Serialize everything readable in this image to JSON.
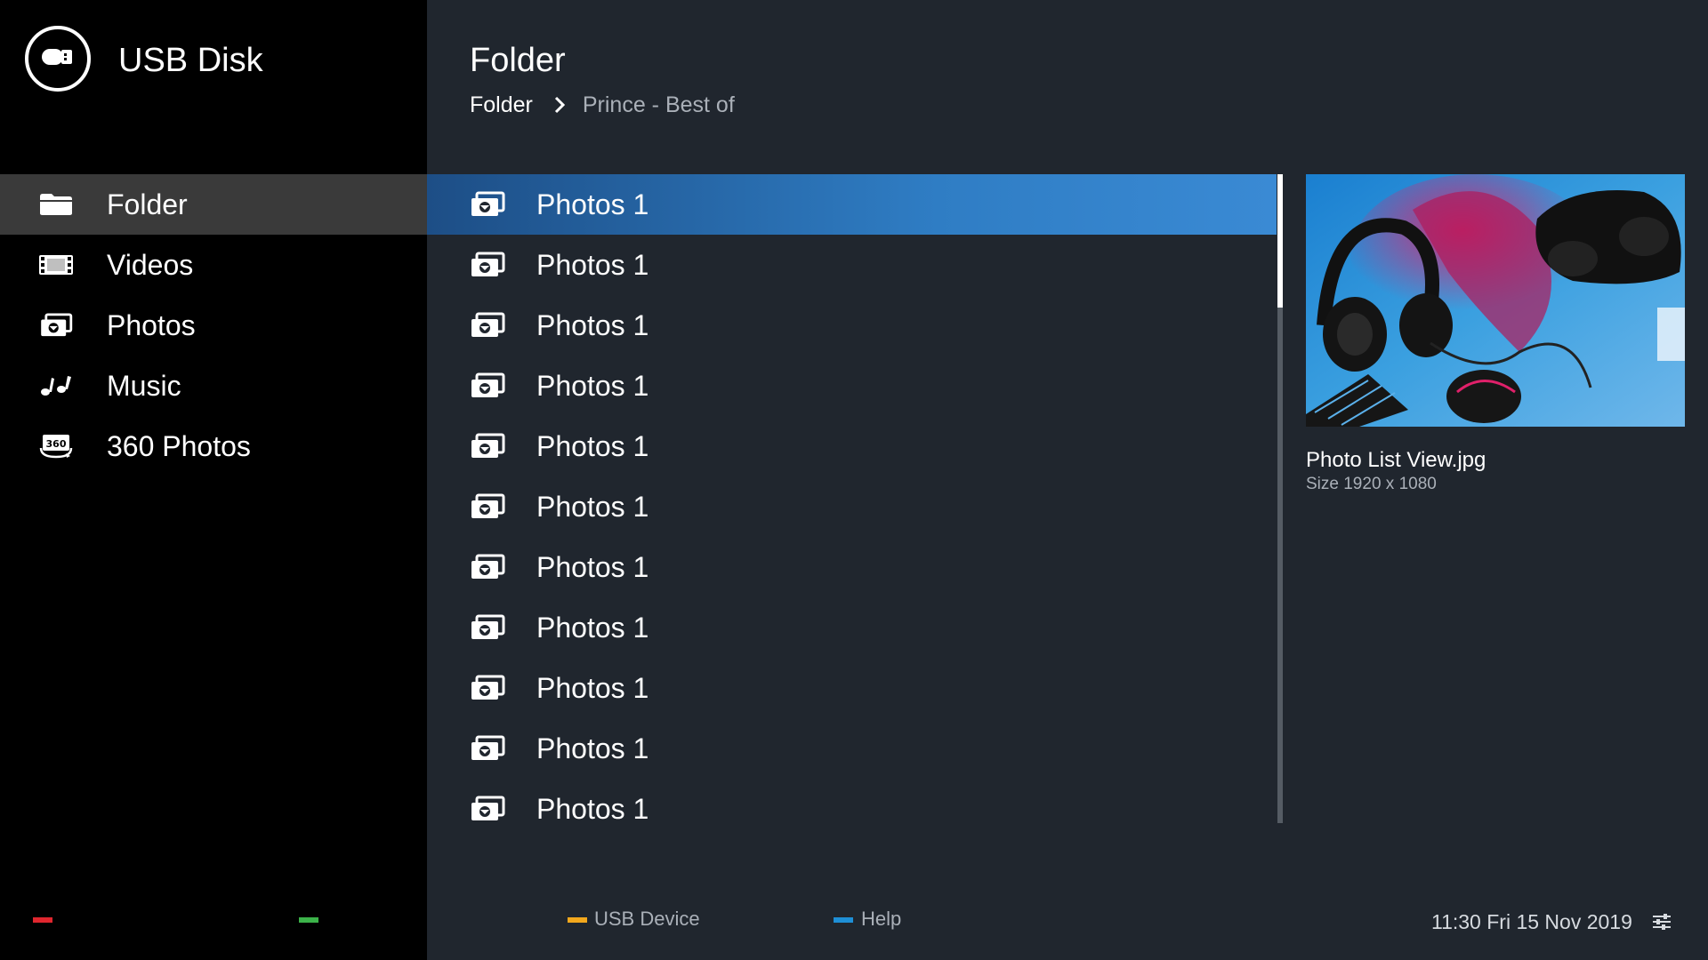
{
  "app": {
    "title": "USB Disk",
    "logo_icon": "usb-drive-icon"
  },
  "sidebar": {
    "items": [
      {
        "label": "Folder",
        "icon": "folder-icon",
        "active": true
      },
      {
        "label": "Videos",
        "icon": "film-icon",
        "active": false
      },
      {
        "label": "Photos",
        "icon": "photos-icon",
        "active": false
      },
      {
        "label": "Music",
        "icon": "music-note-icon",
        "active": false
      },
      {
        "label": "360 Photos",
        "icon": "photo-360-icon",
        "active": false
      }
    ]
  },
  "header": {
    "title": "Folder",
    "breadcrumb": {
      "root": "Folder",
      "current": "Prince - Best of"
    }
  },
  "files": [
    {
      "label": "Photos 1",
      "icon": "photos-icon",
      "selected": true
    },
    {
      "label": "Photos 1",
      "icon": "photos-icon",
      "selected": false
    },
    {
      "label": "Photos 1",
      "icon": "photos-icon",
      "selected": false
    },
    {
      "label": "Photos 1",
      "icon": "photos-icon",
      "selected": false
    },
    {
      "label": "Photos 1",
      "icon": "photos-icon",
      "selected": false
    },
    {
      "label": "Photos 1",
      "icon": "photos-icon",
      "selected": false
    },
    {
      "label": "Photos 1",
      "icon": "photos-icon",
      "selected": false
    },
    {
      "label": "Photos 1",
      "icon": "photos-icon",
      "selected": false
    },
    {
      "label": "Photos 1",
      "icon": "photos-icon",
      "selected": false
    },
    {
      "label": "Photos 1",
      "icon": "photos-icon",
      "selected": false
    },
    {
      "label": "Photos 1",
      "icon": "photos-icon",
      "selected": false
    }
  ],
  "preview": {
    "file_name": "Photo List View.jpg",
    "size_text": "Size 1920 x 1080"
  },
  "footer": {
    "keys": [
      {
        "color": "#e0262e",
        "label": ""
      },
      {
        "color": "#3cb34a",
        "label": ""
      },
      {
        "color": "#f2a81d",
        "label": "USB Device"
      },
      {
        "color": "#1e8fd6",
        "label": "Help"
      }
    ],
    "clock": "11:30 Fri 15 Nov 2019",
    "settings_icon": "settings-sliders-icon"
  },
  "colors": {
    "sidebar_bg": "#000000",
    "main_bg": "#20262e",
    "active_nav": "#3a3a3a",
    "selected_row": "#2f7dc4"
  }
}
